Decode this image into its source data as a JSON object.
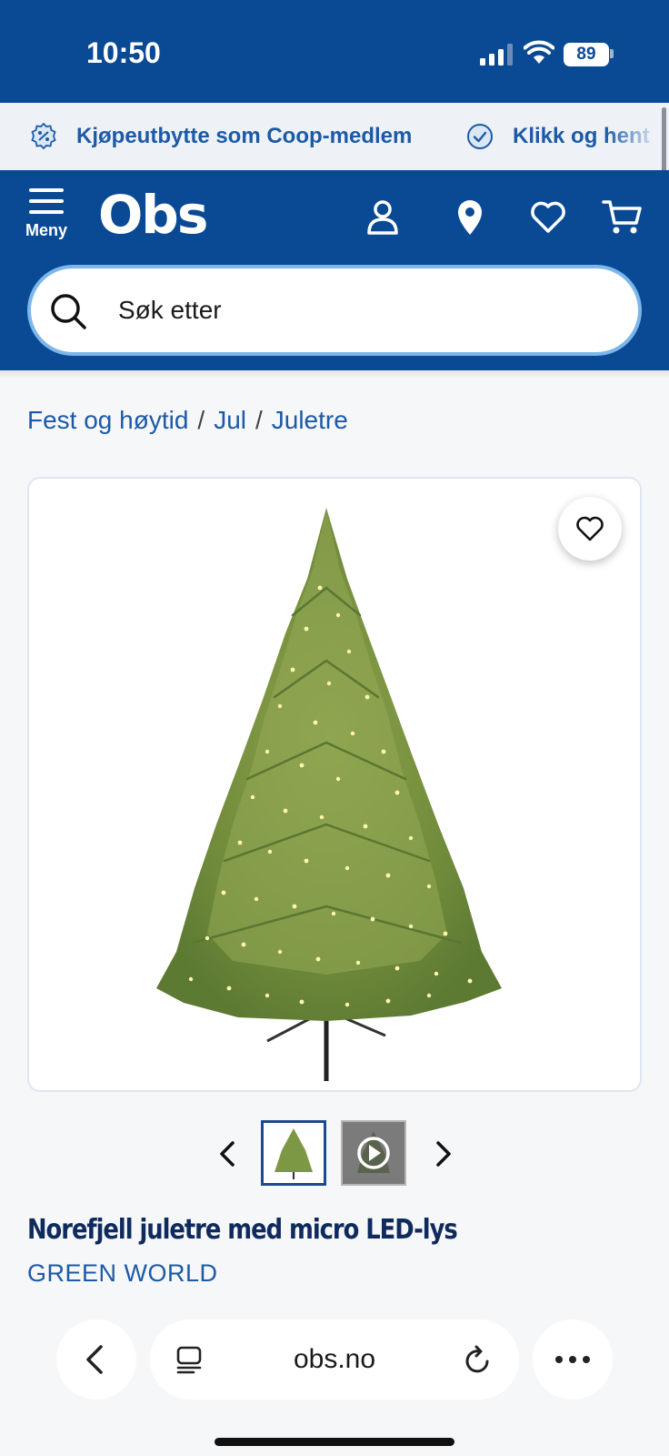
{
  "status": {
    "time": "10:50",
    "battery": "89"
  },
  "promo": {
    "items": [
      {
        "label": "Kjøpeutbytte som Coop-medlem",
        "icon": "percent-badge-icon"
      },
      {
        "label": "Klikk og hent",
        "icon": "check-circle-icon"
      }
    ]
  },
  "header": {
    "menu_label": "Meny",
    "logo": "Obs",
    "search_placeholder": "Søk etter",
    "icons": [
      "user-icon",
      "location-pin-icon",
      "heart-icon",
      "cart-icon"
    ]
  },
  "breadcrumb": [
    "Fest og høytid",
    "Jul",
    "Juletre"
  ],
  "product": {
    "title": "Norefjell juletre med micro LED-lys",
    "brand": "GREEN WORLD"
  },
  "browser": {
    "url": "obs.no"
  },
  "colors": {
    "brand_blue": "#0a4a94",
    "link_blue": "#1c5aa6",
    "title_navy": "#0f2a5c"
  }
}
